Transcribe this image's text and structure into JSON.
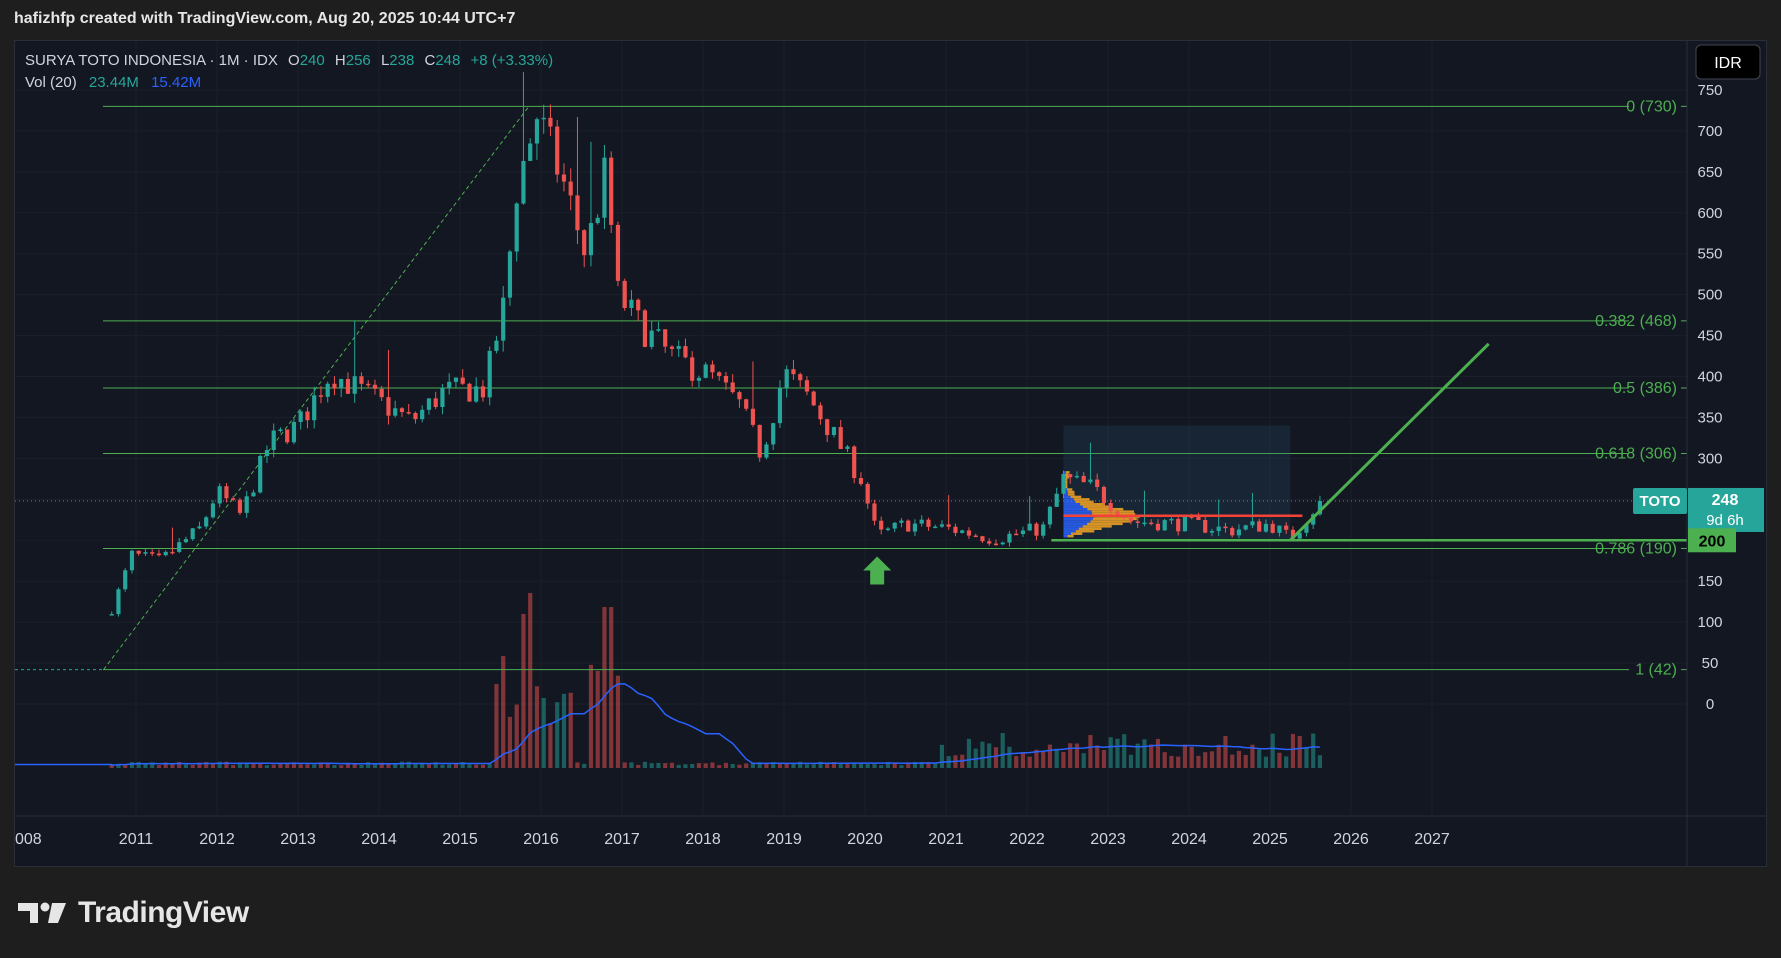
{
  "header": {
    "caption": "hafizhfp created with TradingView.com, Aug 20, 2025 10:44 UTC+7"
  },
  "legend": {
    "symbol": "SURYA TOTO INDONESIA · 1M · IDX",
    "o_label": "O",
    "o_value": "240",
    "h_label": "H",
    "h_value": "256",
    "l_label": "L",
    "l_value": "238",
    "c_label": "C",
    "c_value": "248",
    "change": "+8 (+3.33%)",
    "vol_label": "Vol (20)",
    "vol_value": "23.44M",
    "vol_ma_value": "15.42M"
  },
  "currency_button": "IDR",
  "price_tag": {
    "ticker": "TOTO",
    "price": "248",
    "countdown": "9d 6h"
  },
  "level_tag": "200",
  "footer": {
    "brand": "TradingView"
  },
  "colors": {
    "up": "#26a69a",
    "down": "#ef5350",
    "fib": "#4caf50",
    "vol_ma": "#2962ff",
    "background": "#131722"
  },
  "chart_data": {
    "type": "candlestick",
    "interval": "1M",
    "y_ticks": [
      0,
      50,
      100,
      150,
      200,
      250,
      300,
      350,
      400,
      450,
      500,
      550,
      600,
      650,
      700,
      750
    ],
    "x_ticks": [
      "008",
      "2011",
      "2012",
      "2013",
      "2014",
      "2015",
      "2016",
      "2017",
      "2018",
      "2019",
      "2020",
      "2021",
      "2022",
      "2023",
      "2024",
      "2025",
      "2026",
      "2027"
    ],
    "fib_levels": [
      {
        "label": "0 (730)",
        "value": 730
      },
      {
        "label": "0.382 (468)",
        "value": 468
      },
      {
        "label": "0.5 (386)",
        "value": 386
      },
      {
        "label": "0.618 (306)",
        "value": 306
      },
      {
        "label": "0.786 (190)",
        "value": 190
      },
      {
        "label": "1 (42)",
        "value": 42
      }
    ],
    "anchors": [
      {
        "year": 2010.0,
        "price": 52
      },
      {
        "year": 2010.7,
        "price": 115
      },
      {
        "year": 2010.95,
        "price": 182
      },
      {
        "year": 2011.3,
        "price": 175
      },
      {
        "year": 2011.8,
        "price": 215
      },
      {
        "year": 2012.0,
        "price": 260
      },
      {
        "year": 2012.3,
        "price": 230
      },
      {
        "year": 2012.65,
        "price": 320
      },
      {
        "year": 2013.0,
        "price": 340
      },
      {
        "year": 2013.4,
        "price": 405
      },
      {
        "year": 2013.9,
        "price": 375
      },
      {
        "year": 2014.4,
        "price": 345
      },
      {
        "year": 2014.8,
        "price": 382
      },
      {
        "year": 2015.3,
        "price": 385
      },
      {
        "year": 2015.55,
        "price": 490
      },
      {
        "year": 2015.7,
        "price": 630
      },
      {
        "year": 2015.95,
        "price": 720
      },
      {
        "year": 2016.3,
        "price": 630
      },
      {
        "year": 2016.55,
        "price": 550
      },
      {
        "year": 2016.8,
        "price": 650
      },
      {
        "year": 2016.95,
        "price": 500
      },
      {
        "year": 2017.2,
        "price": 465
      },
      {
        "year": 2017.6,
        "price": 425
      },
      {
        "year": 2018.1,
        "price": 400
      },
      {
        "year": 2018.45,
        "price": 365
      },
      {
        "year": 2018.72,
        "price": 305
      },
      {
        "year": 2019.0,
        "price": 405
      },
      {
        "year": 2019.3,
        "price": 375
      },
      {
        "year": 2019.6,
        "price": 330
      },
      {
        "year": 2019.95,
        "price": 275
      },
      {
        "year": 2020.15,
        "price": 205
      },
      {
        "year": 2020.5,
        "price": 220
      },
      {
        "year": 2021.0,
        "price": 215
      },
      {
        "year": 2021.6,
        "price": 202
      },
      {
        "year": 2022.2,
        "price": 215
      },
      {
        "year": 2022.45,
        "price": 275
      },
      {
        "year": 2022.8,
        "price": 265
      },
      {
        "year": 2023.3,
        "price": 223
      },
      {
        "year": 2024.0,
        "price": 220
      },
      {
        "year": 2024.5,
        "price": 212
      },
      {
        "year": 2025.0,
        "price": 220
      },
      {
        "year": 2025.25,
        "price": 202
      },
      {
        "year": 2025.62,
        "price": 248
      }
    ],
    "volume_spikes": [
      {
        "year": 2015.55,
        "value": 1.6
      },
      {
        "year": 2015.75,
        "value": 2.2
      },
      {
        "year": 2015.9,
        "value": 2.5
      },
      {
        "year": 2016.0,
        "value": 1.0
      },
      {
        "year": 2016.8,
        "value": 2.3
      },
      {
        "year": 2016.9,
        "value": 2.3
      }
    ],
    "range_box": {
      "from_year": 2022.45,
      "to_year": 2025.25,
      "low": 200,
      "high": 340
    },
    "support_line": {
      "from_year": 2022.3,
      "price": 200
    },
    "trend_line": {
      "from_year": 2025.25,
      "from_price": 200,
      "to_year": 2027.7,
      "to_price": 440
    },
    "marker": {
      "type": "arrow-up",
      "year": 2020.15,
      "price": 190
    },
    "last_price": 248
  }
}
